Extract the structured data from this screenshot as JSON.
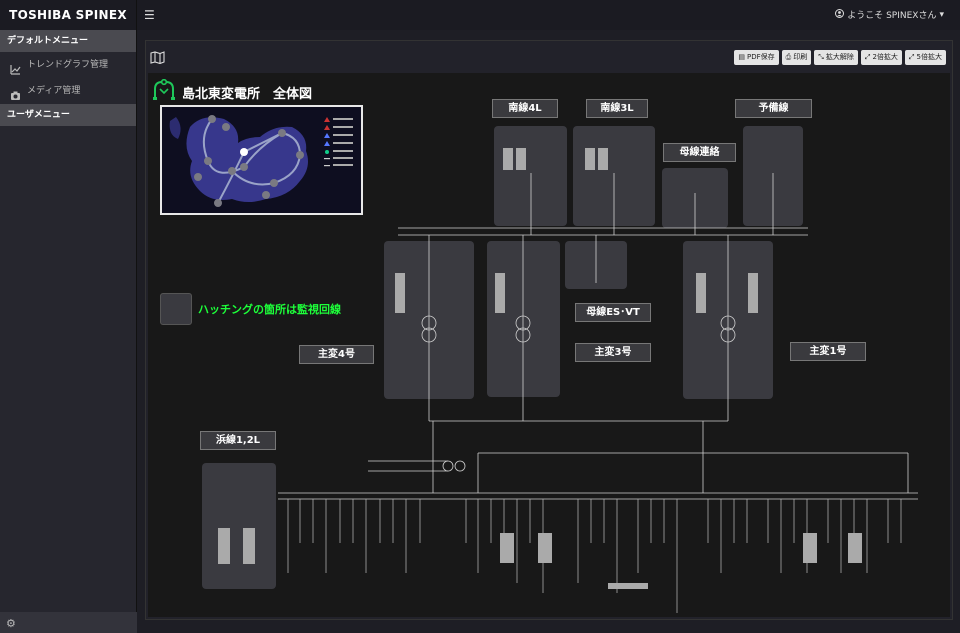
{
  "brand": "TOSHIBA SPINEX",
  "sidebar": {
    "default_menu": "デフォルトメニュー",
    "items": [
      {
        "label": "トレンドグラフ管理",
        "icon": "line-chart-icon"
      },
      {
        "label": "メディア管理",
        "icon": "camera-icon"
      }
    ],
    "user_menu": "ユーザメニュー"
  },
  "topbar": {
    "user_greeting": "ようこそ SPINEXさん"
  },
  "toolbar": {
    "pdf": "PDF保存",
    "print": "印刷",
    "zoom_reset": "拡大解除",
    "zoom2": "2倍拡大",
    "zoom5": "5倍拡大"
  },
  "diagram": {
    "title": "島北東変電所　全体図",
    "note": "ハッチングの箇所は監視回線",
    "labels": {
      "nansen4l": "南線4L",
      "nansen3l": "南線3L",
      "yobisen": "予備線",
      "bosen_renraku": "母線連絡",
      "bosen_es_vt": "母線ES･VT",
      "shuhen4": "主変4号",
      "shuhen3": "主変3号",
      "shuhen1": "主変1号",
      "hamasen": "浜線1,2L"
    }
  },
  "colors": {
    "note": "#1dff3a",
    "background": "#181818"
  }
}
